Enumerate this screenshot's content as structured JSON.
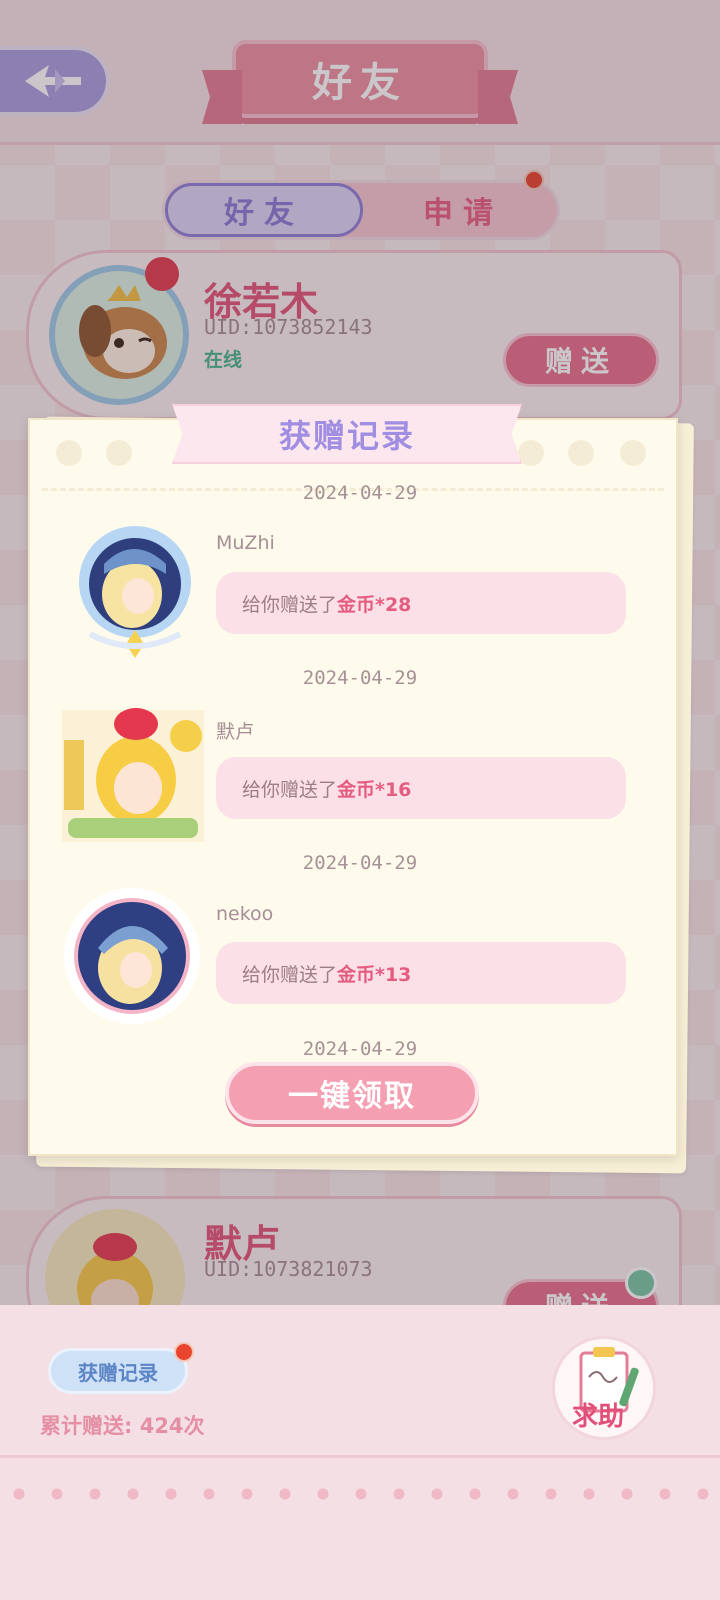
{
  "header": {
    "title": "好友",
    "back_icon": "back-arrow-icon"
  },
  "tabs": [
    {
      "label": "好友",
      "active": true
    },
    {
      "label": "申请",
      "active": false,
      "has_dot": true
    }
  ],
  "friends": [
    {
      "name": "徐若木",
      "uid": "UID:1073852143",
      "status": "在线",
      "gift_label": "赠送"
    },
    {
      "name": "默卢",
      "uid": "UID:1073821073",
      "gift_label": "赠送"
    }
  ],
  "dialog": {
    "title": "获赠记录",
    "records": [
      {
        "date": "2024-04-29",
        "name": "MuZhi",
        "message_prefix": "给你赠送了",
        "item": "金币*28"
      },
      {
        "date": "2024-04-29",
        "name": "默卢",
        "message_prefix": "给你赠送了",
        "item": "金币*16"
      },
      {
        "date": "2024-04-29",
        "name": "nekoo",
        "message_prefix": "给你赠送了",
        "item": "金币*13"
      },
      {
        "date": "2024-04-29"
      }
    ],
    "claim_all_label": "一键领取"
  },
  "bottom": {
    "record_button_label": "获赠记录",
    "total_gift_text": "累计赠送: 424次",
    "help_label": "求助"
  },
  "colors": {
    "accent_pink": "#e7708c",
    "accent_purple": "#8e7fd9",
    "online_green": "#47b48f",
    "notification_red": "#e8442e"
  }
}
